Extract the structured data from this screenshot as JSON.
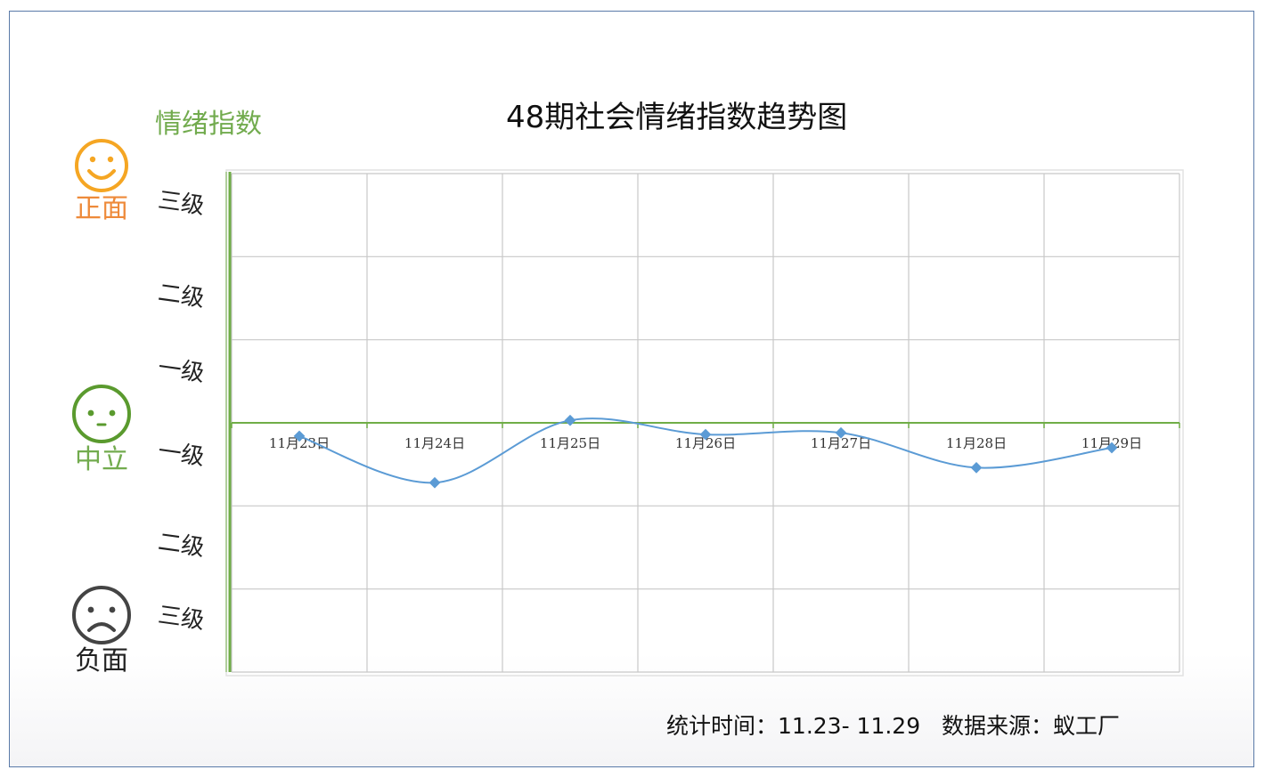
{
  "chart_data": {
    "type": "line",
    "title": "48期社会情绪指数趋势图",
    "ylabel": "情绪指数",
    "categories": [
      "11月23日",
      "11月24日",
      "11月25日",
      "11月26日",
      "11月27日",
      "11月28日",
      "11月29日"
    ],
    "series": [
      {
        "values": [
          -0.16,
          -0.72,
          0.03,
          -0.14,
          -0.12,
          -0.54,
          -0.3
        ]
      }
    ],
    "ylim": [
      -3,
      3
    ],
    "y_levels_top_to_bottom": [
      "三级",
      "二级",
      "一级",
      "一级",
      "二级",
      "三级"
    ],
    "mood_labels": {
      "positive": "正面",
      "neutral": "中立",
      "negative": "负面"
    },
    "grid": true,
    "colors": {
      "line": "#5b9bd5",
      "axis": "#70ad47",
      "grid": "#c8c8c8",
      "positive": "#f5a623",
      "neutral": "#5a9a2e",
      "negative": "#444444"
    }
  },
  "footer": {
    "time_label": "统计时间：",
    "time_range": "11.23- 11.29",
    "source_label": "数据来源：",
    "source_value": "蚁工厂"
  }
}
